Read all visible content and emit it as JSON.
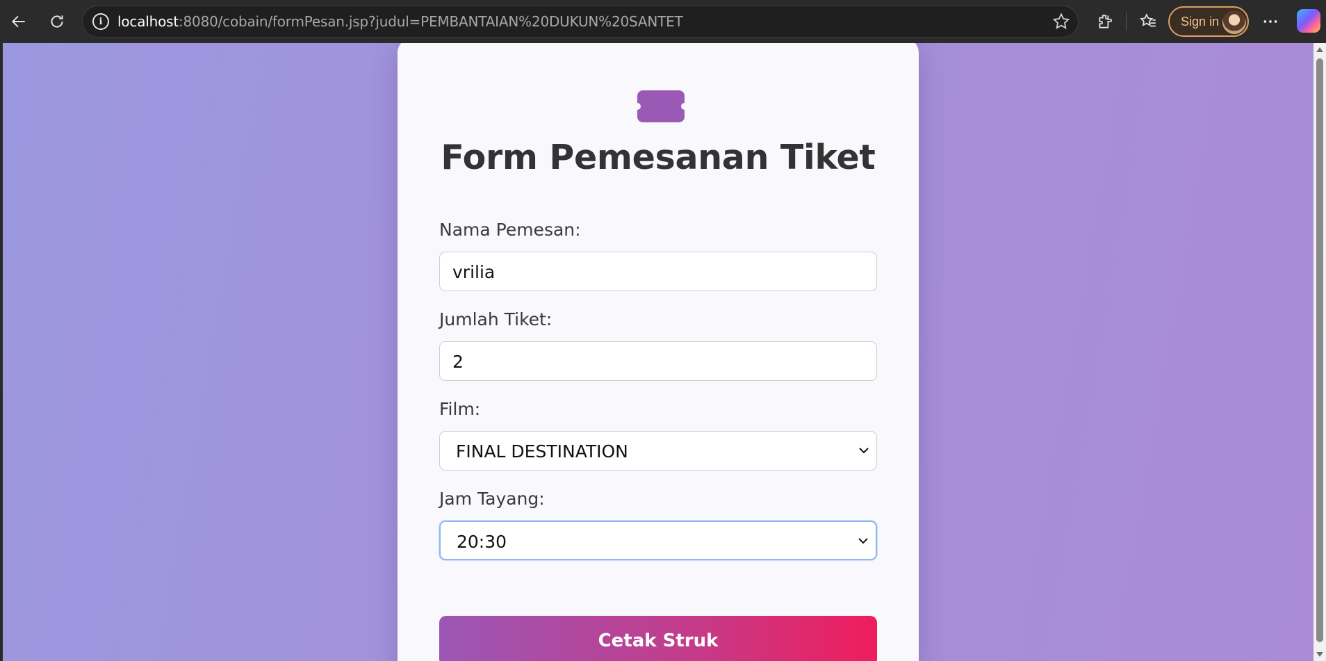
{
  "browser": {
    "url_host": "localhost",
    "url_rest": ":8080/cobain/formPesan.jsp?judul=PEMBANTAIAN%20DUKUN%20SANTET",
    "signin_label": "Sign in",
    "icons": [
      "back-icon",
      "refresh-icon",
      "info-icon",
      "favorite-star-icon",
      "extensions-icon",
      "favorites-icon",
      "avatar",
      "more-icon",
      "copilot-icon"
    ]
  },
  "form": {
    "title": "Form Pemesanan Tiket",
    "icon": "ticket-icon",
    "accent_color": "#9b59b6",
    "name_label": "Nama Pemesan:",
    "name_value": "vrilia",
    "qty_label": "Jumlah Tiket:",
    "qty_value": "2",
    "film_label": "Film:",
    "film_selected": "FINAL DESTINATION",
    "time_label": "Jam Tayang:",
    "time_selected": "20:30",
    "submit_label": "Cetak Struk",
    "button_gradient": [
      "#9b57b6",
      "#ef1d5d"
    ]
  }
}
